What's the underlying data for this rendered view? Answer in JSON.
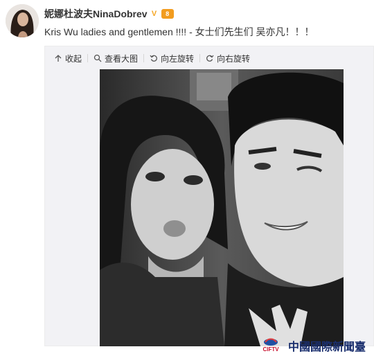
{
  "post": {
    "username": "妮娜杜波夫NinaDobrev",
    "verified_badge": "V",
    "level_badge": "8",
    "text": "Kris Wu ladies and gentlemen !!!! - 女士们先生们 吴亦凡！！！"
  },
  "toolbar": {
    "collapse_label": "收起",
    "view_large_label": "查看大图",
    "rotate_left_label": "向左旋转",
    "rotate_right_label": "向右旋转"
  },
  "watermark": {
    "logo_text": "CIFTV",
    "text": "中國國際新聞臺"
  },
  "colors": {
    "accent_text": "#333333",
    "verified": "#f5a623",
    "level_badge": "#f29c1f",
    "watermark": "#1a2f6e"
  },
  "icons": [
    "avatar",
    "verified-icon",
    "level-badge-icon",
    "arrow-up-icon",
    "search-icon",
    "rotate-left-icon",
    "rotate-right-icon",
    "ciftv-logo-icon"
  ]
}
